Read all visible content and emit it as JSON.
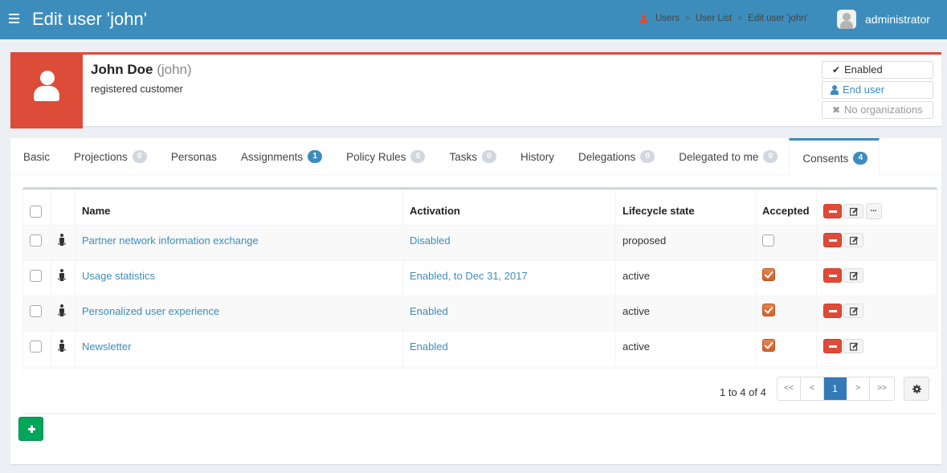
{
  "header": {
    "title": "Edit user 'john'",
    "breadcrumb": [
      "Users",
      "User List",
      "Edit user 'john'"
    ],
    "breadcrumb_separator": ">",
    "user_name": "administrator",
    "color": "#3c8dbc"
  },
  "summary": {
    "display_name": "John Doe",
    "login": "(john)",
    "description": "registered customer",
    "accent_color": "#dd4b39",
    "tags": [
      {
        "icon": "check-icon",
        "label": "Enabled"
      },
      {
        "icon": "user-icon",
        "label": "End user"
      },
      {
        "icon": "times-icon",
        "label": "No organizations"
      }
    ]
  },
  "tabs": [
    {
      "label": "Basic",
      "count": null
    },
    {
      "label": "Projections",
      "count": "0"
    },
    {
      "label": "Personas",
      "count": null
    },
    {
      "label": "Assignments",
      "count": "1"
    },
    {
      "label": "Policy Rules",
      "count": "0"
    },
    {
      "label": "Tasks",
      "count": "0"
    },
    {
      "label": "History",
      "count": null
    },
    {
      "label": "Delegations",
      "count": "0"
    },
    {
      "label": "Delegated to me",
      "count": "0"
    },
    {
      "label": "Consents",
      "count": "4",
      "active": true
    }
  ],
  "table": {
    "columns": [
      "Name",
      "Activation",
      "Lifecycle state",
      "Accepted"
    ],
    "rows": [
      {
        "name": "Partner network information exchange",
        "activation": "Disabled",
        "lifecycle": "proposed",
        "accepted": false
      },
      {
        "name": "Usage statistics",
        "activation": "Enabled, to Dec 31, 2017",
        "lifecycle": "active",
        "accepted": true
      },
      {
        "name": "Personalized user experience",
        "activation": "Enabled",
        "lifecycle": "active",
        "accepted": true
      },
      {
        "name": "Newsletter",
        "activation": "Enabled",
        "lifecycle": "active",
        "accepted": true
      }
    ],
    "more_label": "...",
    "paging_info": "1 to 4 of 4",
    "pager": {
      "first": "<<",
      "prev": "<",
      "current": "1",
      "next": ">",
      "last": ">>"
    }
  }
}
